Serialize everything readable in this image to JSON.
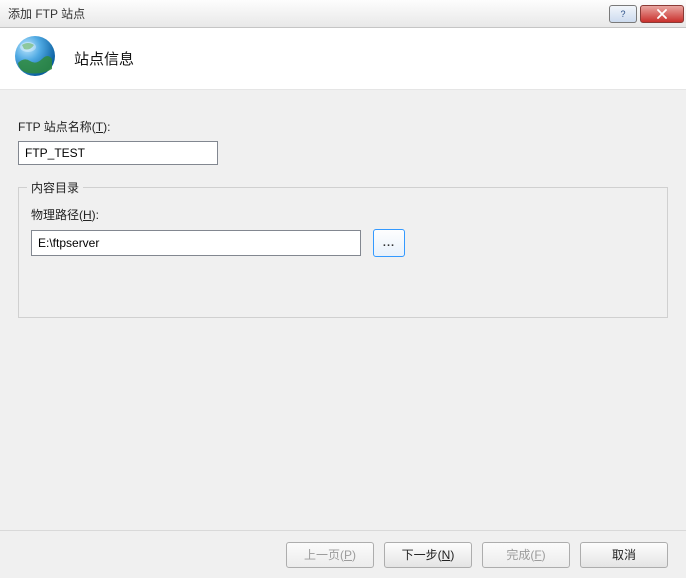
{
  "window": {
    "title": "添加 FTP 站点"
  },
  "header": {
    "title": "站点信息"
  },
  "form": {
    "siteNameLabelPrefix": "FTP 站点名称(",
    "siteNameHotkey": "T",
    "siteNameLabelSuffix": "):",
    "siteNameValue": "FTP_TEST",
    "fieldsetLegend": "内容目录",
    "physicalPathLabelPrefix": "物理路径(",
    "physicalPathHotkey": "H",
    "physicalPathLabelSuffix": "):",
    "physicalPathValue": "E:\\ftpserver",
    "browseDots": "..."
  },
  "footer": {
    "prev": {
      "pre": "上一页(",
      "hk": "P",
      "suf": ")"
    },
    "next": {
      "pre": "下一步(",
      "hk": "N",
      "suf": ")"
    },
    "finish": {
      "pre": "完成(",
      "hk": "F",
      "suf": ")"
    },
    "cancel": "取消"
  }
}
